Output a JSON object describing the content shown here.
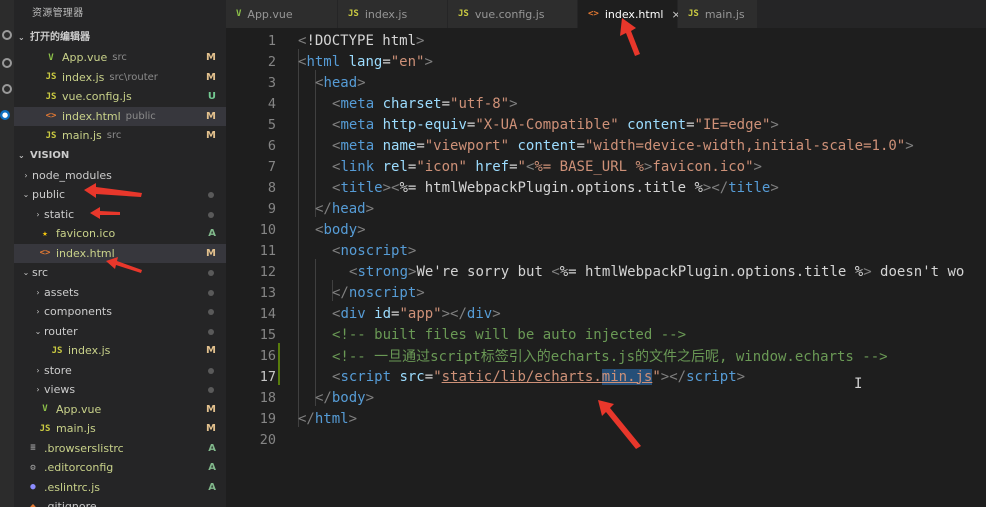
{
  "sidebar": {
    "title": "资源管理器",
    "open_editors_header": "打开的编辑器",
    "open_editors": [
      {
        "icon": "V",
        "icon_class": "vue",
        "name": "App.vue",
        "desc": "src",
        "badge": "M",
        "badge_class": "M"
      },
      {
        "icon": "JS",
        "icon_class": "js",
        "name": "index.js",
        "desc": "src\\router",
        "badge": "M",
        "badge_class": "M"
      },
      {
        "icon": "JS",
        "icon_class": "js",
        "name": "vue.config.js",
        "desc": "",
        "badge": "U",
        "badge_class": "U"
      },
      {
        "icon": "<>",
        "icon_class": "html",
        "name": "index.html",
        "desc": "public",
        "badge": "M",
        "badge_class": "M"
      },
      {
        "icon": "JS",
        "icon_class": "js",
        "name": "main.js",
        "desc": "src",
        "badge": "M",
        "badge_class": "M"
      }
    ],
    "project_header": "VISION",
    "tree": [
      {
        "level": 1,
        "chev": "›",
        "icon": "",
        "name": "node_modules",
        "badge": "",
        "dot": false
      },
      {
        "level": 1,
        "chev": "⌄",
        "icon": "",
        "name": "public",
        "badge": "",
        "dot": true
      },
      {
        "level": 2,
        "chev": "›",
        "icon": "",
        "name": "static",
        "badge": "",
        "dot": true
      },
      {
        "level": 2,
        "chev": "",
        "icon": "★",
        "icon_class": "star",
        "name": "favicon.ico",
        "badge": "A",
        "badge_class": "A"
      },
      {
        "level": 2,
        "chev": "",
        "icon": "<>",
        "icon_class": "html",
        "name": "index.html",
        "badge": "M",
        "badge_class": "M",
        "selected": true
      },
      {
        "level": 1,
        "chev": "⌄",
        "icon": "",
        "name": "src",
        "badge": "",
        "dot": true
      },
      {
        "level": 2,
        "chev": "›",
        "icon": "",
        "name": "assets",
        "badge": "",
        "dot": true
      },
      {
        "level": 2,
        "chev": "›",
        "icon": "",
        "name": "components",
        "badge": "",
        "dot": true
      },
      {
        "level": 2,
        "chev": "⌄",
        "icon": "",
        "name": "router",
        "badge": "",
        "dot": true
      },
      {
        "level": 3,
        "chev": "",
        "icon": "JS",
        "icon_class": "js",
        "name": "index.js",
        "badge": "M",
        "badge_class": "M"
      },
      {
        "level": 2,
        "chev": "›",
        "icon": "",
        "name": "store",
        "badge": "",
        "dot": true
      },
      {
        "level": 2,
        "chev": "›",
        "icon": "",
        "name": "views",
        "badge": "",
        "dot": true
      },
      {
        "level": 2,
        "chev": "",
        "icon": "V",
        "icon_class": "vue",
        "name": "App.vue",
        "badge": "M",
        "badge_class": "M"
      },
      {
        "level": 2,
        "chev": "",
        "icon": "JS",
        "icon_class": "js",
        "name": "main.js",
        "badge": "M",
        "badge_class": "M"
      },
      {
        "level": 1,
        "chev": "",
        "icon": "≡",
        "icon_class": "cfg",
        "name": ".browserslistrc",
        "badge": "A",
        "badge_class": "A"
      },
      {
        "level": 1,
        "chev": "",
        "icon": "⚙",
        "icon_class": "cfg",
        "name": ".editorconfig",
        "badge": "A",
        "badge_class": "A"
      },
      {
        "level": 1,
        "chev": "",
        "icon": "●",
        "icon_class": "eslint",
        "name": ".eslintrc.js",
        "badge": "A",
        "badge_class": "A"
      },
      {
        "level": 1,
        "chev": "",
        "icon": "◆",
        "icon_class": "html",
        "name": ".gitignore",
        "badge": "",
        "dot": false
      }
    ]
  },
  "tabs": [
    {
      "icon": "V",
      "icon_class": "vue",
      "label": "App.vue",
      "active": false
    },
    {
      "icon": "JS",
      "icon_class": "js",
      "label": "index.js",
      "active": false
    },
    {
      "icon": "JS",
      "icon_class": "js",
      "label": "vue.config.js",
      "active": false
    },
    {
      "icon": "<>",
      "icon_class": "html",
      "label": "index.html",
      "active": true,
      "close": "×"
    },
    {
      "icon": "JS",
      "icon_class": "js",
      "label": "main.js",
      "active": false
    }
  ],
  "editor": {
    "current_line": 17,
    "lines": [
      {
        "n": "1",
        "indent": 0,
        "tokens": [
          [
            "t-punc",
            "<"
          ],
          [
            "t-txt",
            "!DOCTYPE html"
          ],
          [
            "t-punc",
            ">"
          ]
        ]
      },
      {
        "n": "2",
        "indent": 0,
        "tokens": [
          [
            "t-punc",
            "<"
          ],
          [
            "t-tag",
            "html"
          ],
          [
            "t-txt",
            " "
          ],
          [
            "t-attr",
            "lang"
          ],
          [
            "t-txt",
            "="
          ],
          [
            "t-str",
            "\"en\""
          ],
          [
            "t-punc",
            ">"
          ]
        ]
      },
      {
        "n": "3",
        "indent": 1,
        "tokens": [
          [
            "t-punc",
            "<"
          ],
          [
            "t-tag",
            "head"
          ],
          [
            "t-punc",
            ">"
          ]
        ]
      },
      {
        "n": "4",
        "indent": 2,
        "tokens": [
          [
            "t-punc",
            "<"
          ],
          [
            "t-tag",
            "meta"
          ],
          [
            "t-txt",
            " "
          ],
          [
            "t-attr",
            "charset"
          ],
          [
            "t-txt",
            "="
          ],
          [
            "t-str",
            "\"utf-8\""
          ],
          [
            "t-punc",
            ">"
          ]
        ]
      },
      {
        "n": "5",
        "indent": 2,
        "tokens": [
          [
            "t-punc",
            "<"
          ],
          [
            "t-tag",
            "meta"
          ],
          [
            "t-txt",
            " "
          ],
          [
            "t-attr",
            "http-equiv"
          ],
          [
            "t-txt",
            "="
          ],
          [
            "t-str",
            "\"X-UA-Compatible\""
          ],
          [
            "t-txt",
            " "
          ],
          [
            "t-attr",
            "content"
          ],
          [
            "t-txt",
            "="
          ],
          [
            "t-str",
            "\"IE=edge\""
          ],
          [
            "t-punc",
            ">"
          ]
        ]
      },
      {
        "n": "6",
        "indent": 2,
        "tokens": [
          [
            "t-punc",
            "<"
          ],
          [
            "t-tag",
            "meta"
          ],
          [
            "t-txt",
            " "
          ],
          [
            "t-attr",
            "name"
          ],
          [
            "t-txt",
            "="
          ],
          [
            "t-str",
            "\"viewport\""
          ],
          [
            "t-txt",
            " "
          ],
          [
            "t-attr",
            "content"
          ],
          [
            "t-txt",
            "="
          ],
          [
            "t-str",
            "\"width=device-width,initial-scale=1.0\""
          ],
          [
            "t-punc",
            ">"
          ]
        ]
      },
      {
        "n": "7",
        "indent": 2,
        "tokens": [
          [
            "t-punc",
            "<"
          ],
          [
            "t-tag",
            "link"
          ],
          [
            "t-txt",
            " "
          ],
          [
            "t-attr",
            "rel"
          ],
          [
            "t-txt",
            "="
          ],
          [
            "t-str",
            "\"icon\""
          ],
          [
            "t-txt",
            " "
          ],
          [
            "t-attr",
            "href"
          ],
          [
            "t-txt",
            "="
          ],
          [
            "t-str",
            "\""
          ],
          [
            "t-punc",
            "<"
          ],
          [
            "t-str",
            "%= BASE_URL %"
          ],
          [
            "t-punc",
            ">"
          ],
          [
            "t-str",
            "favicon.ico\""
          ],
          [
            "t-punc",
            ">"
          ]
        ]
      },
      {
        "n": "8",
        "indent": 2,
        "tokens": [
          [
            "t-punc",
            "<"
          ],
          [
            "t-tag",
            "title"
          ],
          [
            "t-punc",
            "><"
          ],
          [
            "t-tmpl",
            "%= htmlWebpackPlugin.options.title %"
          ],
          [
            "t-punc",
            "></"
          ],
          [
            "t-tag",
            "title"
          ],
          [
            "t-punc",
            ">"
          ]
        ]
      },
      {
        "n": "9",
        "indent": 1,
        "tokens": [
          [
            "t-punc",
            "</"
          ],
          [
            "t-tag",
            "head"
          ],
          [
            "t-punc",
            ">"
          ]
        ]
      },
      {
        "n": "10",
        "indent": 1,
        "tokens": [
          [
            "t-punc",
            "<"
          ],
          [
            "t-tag",
            "body"
          ],
          [
            "t-punc",
            ">"
          ]
        ]
      },
      {
        "n": "11",
        "indent": 2,
        "tokens": [
          [
            "t-punc",
            "<"
          ],
          [
            "t-tag",
            "noscript"
          ],
          [
            "t-punc",
            ">"
          ]
        ]
      },
      {
        "n": "12",
        "indent": 3,
        "tokens": [
          [
            "t-punc",
            "<"
          ],
          [
            "t-tag",
            "strong"
          ],
          [
            "t-punc",
            ">"
          ],
          [
            "t-txt",
            "We're sorry but "
          ],
          [
            "t-punc",
            "<"
          ],
          [
            "t-txt",
            "%= htmlWebpackPlugin.options.title %"
          ],
          [
            "t-punc",
            ">"
          ],
          [
            "t-txt",
            " doesn't wo"
          ]
        ]
      },
      {
        "n": "13",
        "indent": 2,
        "tokens": [
          [
            "t-punc",
            "</"
          ],
          [
            "t-tag",
            "noscript"
          ],
          [
            "t-punc",
            ">"
          ]
        ]
      },
      {
        "n": "14",
        "indent": 2,
        "tokens": [
          [
            "t-punc",
            "<"
          ],
          [
            "t-tag",
            "div"
          ],
          [
            "t-txt",
            " "
          ],
          [
            "t-attr",
            "id"
          ],
          [
            "t-txt",
            "="
          ],
          [
            "t-str",
            "\"app\""
          ],
          [
            "t-punc",
            "></"
          ],
          [
            "t-tag",
            "div"
          ],
          [
            "t-punc",
            ">"
          ]
        ]
      },
      {
        "n": "15",
        "indent": 2,
        "tokens": [
          [
            "t-com",
            "<!-- built files will be auto injected -->"
          ]
        ]
      },
      {
        "n": "16",
        "indent": 2,
        "tokens": [
          [
            "t-com",
            "<!-- 一旦通过script标签引入的echarts.js的文件之后呢, window.echarts -->"
          ]
        ]
      },
      {
        "n": "17",
        "indent": 2,
        "tokens": [
          [
            "t-punc",
            "<"
          ],
          [
            "t-tag",
            "script"
          ],
          [
            "t-txt",
            " "
          ],
          [
            "t-attr",
            "src"
          ],
          [
            "t-txt",
            "="
          ],
          [
            "t-str",
            "\""
          ],
          [
            "t-str t-und",
            "static/lib/echarts."
          ],
          [
            "t-str t-und t-hl",
            "min.js"
          ],
          [
            "t-str",
            "\""
          ],
          [
            "t-punc",
            "></"
          ],
          [
            "t-tag",
            "script"
          ],
          [
            "t-punc",
            ">"
          ]
        ]
      },
      {
        "n": "18",
        "indent": 1,
        "tokens": [
          [
            "t-punc",
            "</"
          ],
          [
            "t-tag",
            "body"
          ],
          [
            "t-punc",
            ">"
          ]
        ]
      },
      {
        "n": "19",
        "indent": 0,
        "tokens": [
          [
            "t-punc",
            "</"
          ],
          [
            "t-tag",
            "html"
          ],
          [
            "t-punc",
            ">"
          ]
        ]
      },
      {
        "n": "20",
        "indent": 0,
        "tokens": []
      }
    ]
  },
  "colors": {
    "annotation_red": "#e8372b",
    "accent": "#0e70c0"
  }
}
